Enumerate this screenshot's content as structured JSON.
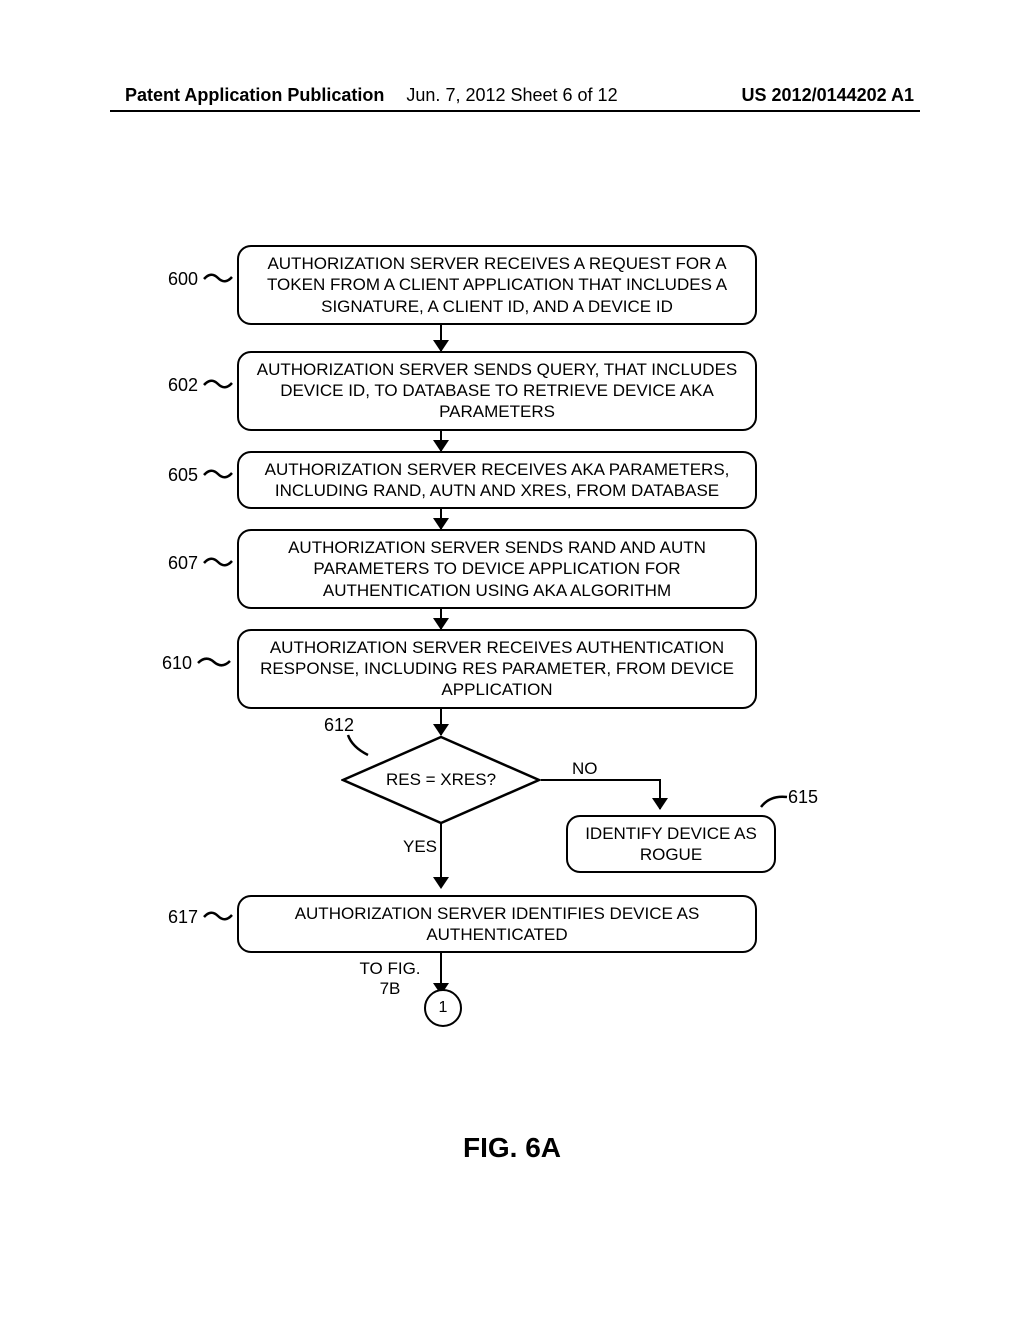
{
  "header": {
    "left": "Patent Application Publication",
    "mid": "Jun. 7, 2012  Sheet 6 of 12",
    "right": "US 2012/0144202 A1"
  },
  "steps": {
    "s600": {
      "ref": "600",
      "text": "AUTHORIZATION SERVER RECEIVES A REQUEST FOR A TOKEN FROM A CLIENT APPLICATION THAT INCLUDES A SIGNATURE, A CLIENT ID, AND A DEVICE ID"
    },
    "s602": {
      "ref": "602",
      "text": "AUTHORIZATION SERVER SENDS QUERY, THAT INCLUDES DEVICE ID, TO DATABASE TO RETRIEVE DEVICE AKA PARAMETERS"
    },
    "s605": {
      "ref": "605",
      "text": "AUTHORIZATION SERVER RECEIVES AKA PARAMETERS, INCLUDING RAND, AUTN AND XRES, FROM DATABASE"
    },
    "s607": {
      "ref": "607",
      "text": "AUTHORIZATION SERVER SENDS RAND AND AUTN PARAMETERS TO DEVICE APPLICATION FOR AUTHENTICATION USING AKA ALGORITHM"
    },
    "s610": {
      "ref": "610",
      "text": "AUTHORIZATION SERVER RECEIVES AUTHENTICATION RESPONSE, INCLUDING RES PARAMETER, FROM DEVICE APPLICATION"
    },
    "s612": {
      "ref": "612",
      "text": "RES = XRES?"
    },
    "s615": {
      "ref": "615",
      "text": "IDENTIFY DEVICE AS ROGUE"
    },
    "s617": {
      "ref": "617",
      "text": "AUTHORIZATION SERVER IDENTIFIES DEVICE AS AUTHENTICATED"
    }
  },
  "branches": {
    "yes": "YES",
    "no": "NO"
  },
  "connector": {
    "to": "TO FIG. 7B",
    "num": "1"
  },
  "figlabel": "FIG. 6A"
}
